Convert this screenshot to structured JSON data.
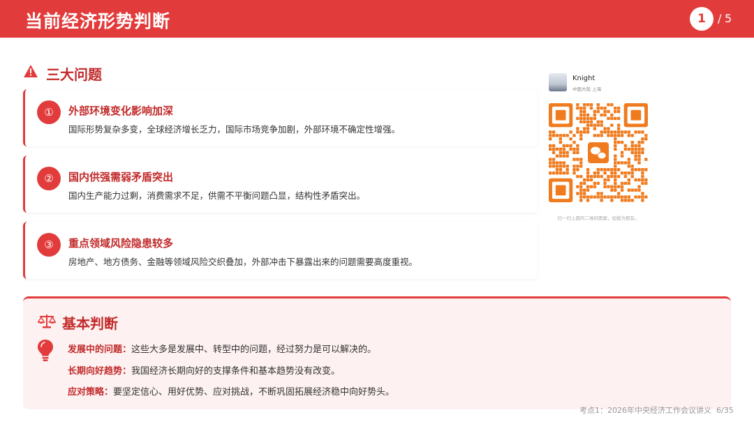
{
  "header": {
    "title": "当前经济形势判断",
    "page_current": "1",
    "page_sep": "/",
    "page_total": "5"
  },
  "problems": {
    "icon": "warning-icon",
    "title": "三大问题",
    "items": [
      {
        "num": "①",
        "title": "外部环境变化影响加深",
        "desc": "国际形势复杂多变，全球经济增长乏力，国际市场竞争加剧，外部环境不确定性增强。"
      },
      {
        "num": "②",
        "title": "国内供强需弱矛盾突出",
        "desc": "国内生产能力过剩，消费需求不足，供需不平衡问题凸显，结构性矛盾突出。"
      },
      {
        "num": "③",
        "title": "重点领域风险隐患较多",
        "desc": "房地产、地方债务、金融等领域风险交织叠加，外部冲击下暴露出来的问题需要高度重视。"
      }
    ]
  },
  "qr": {
    "name": "Knight",
    "location": "中国大陆 上海",
    "caption": "扫一扫上面的二维码图案，加我为朋友。",
    "center_icon": "wechat-icon"
  },
  "judgement": {
    "icon": "scale-icon",
    "title": "基本判断",
    "bulb_icon": "lightbulb-icon",
    "rows": [
      {
        "label": "发展中的问题：",
        "text": "这些大多是发展中、转型中的问题，经过努力是可以解决的。"
      },
      {
        "label": "长期向好趋势：",
        "text": "我国经济长期向好的支撑条件和基本趋势没有改变。"
      },
      {
        "label": "应对策略：",
        "text": "要坚定信心、用好优势、应对挑战，不断巩固拓展经济稳中向好势头。"
      }
    ]
  },
  "footer": {
    "text": "考点1：2026年中央经济工作会议讲义",
    "page": "6/35"
  },
  "colors": {
    "accent": "#e23b3b",
    "accent_dark": "#c22a2a",
    "panel_bg": "#fdf1f1",
    "qr_orange": "#f07b1e"
  }
}
